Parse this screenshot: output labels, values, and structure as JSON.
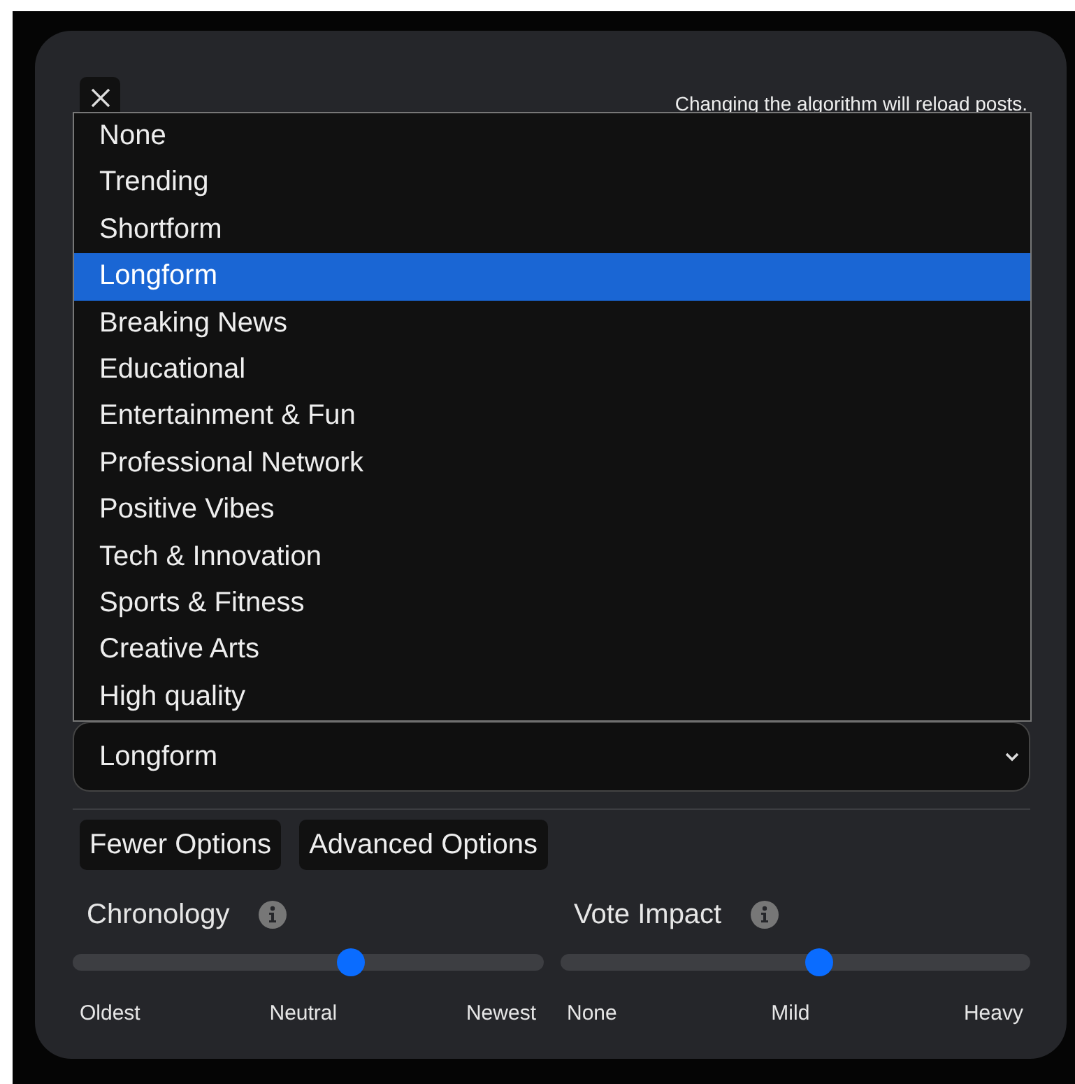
{
  "dialog": {
    "notice": "Changing the algorithm will reload posts.",
    "algorithm_select": {
      "value": "Longform",
      "expanded": true,
      "options": [
        {
          "label": "None",
          "selected": false
        },
        {
          "label": "Trending",
          "selected": false
        },
        {
          "label": "Shortform",
          "selected": false
        },
        {
          "label": "Longform",
          "selected": true
        },
        {
          "label": "Breaking News",
          "selected": false
        },
        {
          "label": "Educational",
          "selected": false
        },
        {
          "label": "Entertainment & Fun",
          "selected": false
        },
        {
          "label": "Professional Network",
          "selected": false
        },
        {
          "label": "Positive Vibes",
          "selected": false
        },
        {
          "label": "Tech & Innovation",
          "selected": false
        },
        {
          "label": "Sports & Fitness",
          "selected": false
        },
        {
          "label": "Creative Arts",
          "selected": false
        },
        {
          "label": "High quality",
          "selected": false
        }
      ]
    },
    "buttons": [
      "Fewer Options",
      "Advanced Options"
    ],
    "sliders": [
      {
        "label": "Chronology",
        "level": 0.59,
        "ticks": [
          "Oldest",
          "Neutral",
          "Newest"
        ]
      },
      {
        "label": "Vote Impact",
        "level": 0.55,
        "ticks": [
          "None",
          "Mild",
          "Heavy"
        ]
      }
    ]
  }
}
